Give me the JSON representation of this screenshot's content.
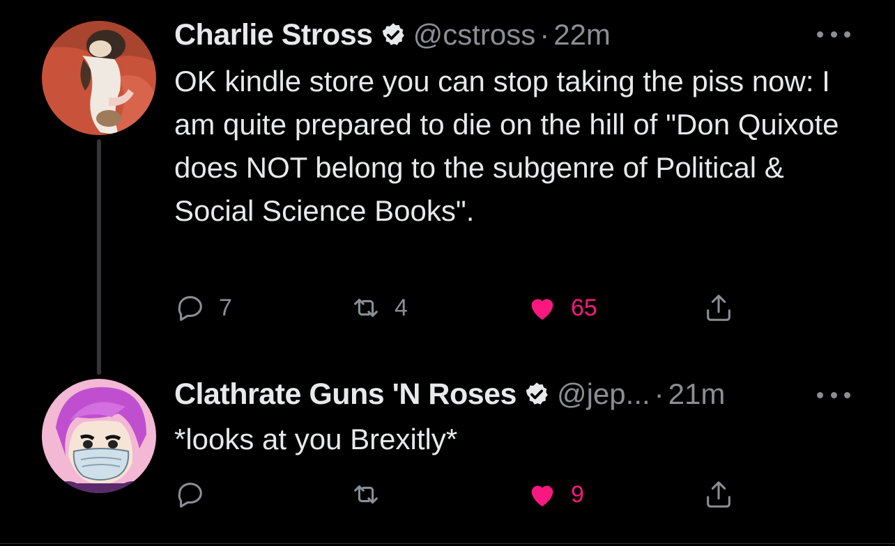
{
  "tweets": [
    {
      "name": "Charlie Stross",
      "handle": "@cstross",
      "separator": "·",
      "time": "22m",
      "text": "OK kindle store you can stop taking the piss now: I am quite prepared to die on the hill of \"Don Quixote does NOT belong to the subgenre of Political & Social Science Books\".",
      "replies": "7",
      "retweets": "4",
      "likes": "65",
      "liked": true,
      "verified": true,
      "avatar_icon": "cat-photo-avatar"
    },
    {
      "name": "Clathrate Guns 'N Roses",
      "handle": "@jep...",
      "separator": "·",
      "time": "21m",
      "text": "*looks at you Brexitly*",
      "replies": "",
      "retweets": "",
      "likes": "9",
      "liked": true,
      "verified": true,
      "avatar_icon": "masked-anime-character-avatar"
    }
  ],
  "colors": {
    "background": "#000000",
    "text": "#e7e9ea",
    "muted": "#8b8f94",
    "like": "#f91880",
    "verified_badge": "#e7e9ea"
  },
  "icons": {
    "reply": "reply-icon",
    "retweet": "retweet-icon",
    "like": "heart-icon",
    "share": "share-icon",
    "more": "more-options-icon",
    "verified": "verified-badge-icon"
  }
}
